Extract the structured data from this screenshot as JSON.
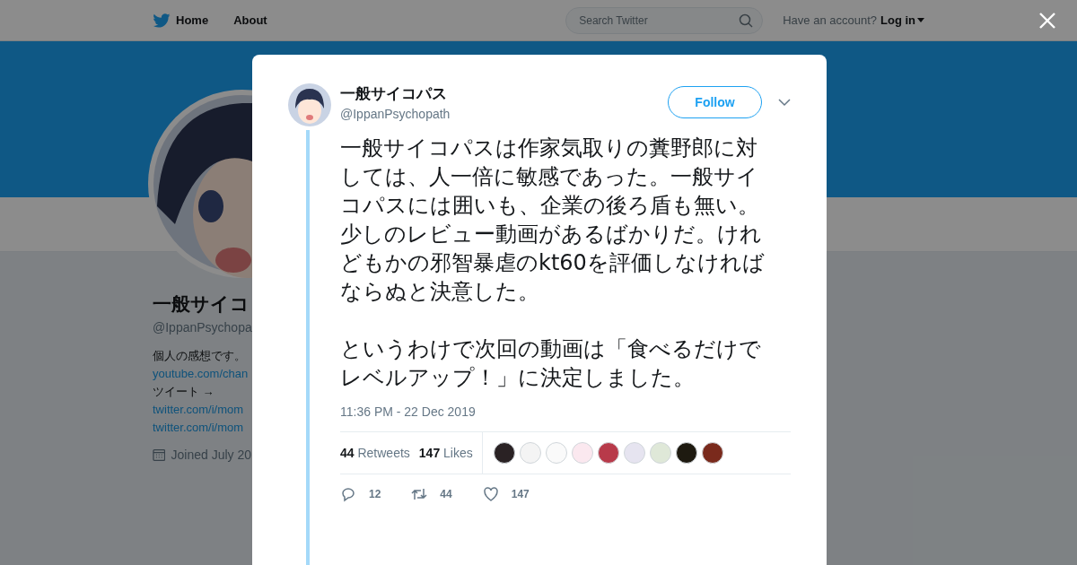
{
  "nav": {
    "items": [
      {
        "label": "Home"
      },
      {
        "label": "About"
      }
    ],
    "search": {
      "placeholder": "Search Twitter"
    },
    "account_prompt": "Have an account?",
    "login": "Log in"
  },
  "profile": {
    "name": "一般サイコ",
    "handle": "@IppanPsychopa",
    "bio": [
      {
        "kind": "text",
        "text": "個人の感想です。"
      },
      {
        "kind": "link",
        "text": "youtube.com/chan"
      },
      {
        "kind": "text",
        "text": "ツイート →"
      },
      {
        "kind": "link",
        "text": "twitter.com/i/mom"
      },
      {
        "kind": "link",
        "text": "twitter.com/i/mom"
      }
    ],
    "joined": "Joined July 20"
  },
  "tweet": {
    "name": "一般サイコパス",
    "handle": "@IppanPsychopath",
    "follow": "Follow",
    "paragraphs": [
      "一般サイコパスは作家気取りの糞野郎に対しては、人一倍に敏感であった。一般サイコパスには囲いも、企業の後ろ盾も無い。少しのレビュー動画があるばかりだ。けれどもかの邪智暴虐のkt60を評価しなければならぬと決意した。",
      "というわけで次回の動画は「食べるだけでレベルアップ！」に決定しました。"
    ],
    "time": "11:36 PM - 22 Dec 2019",
    "stats": [
      {
        "count": "44",
        "label": "Retweets"
      },
      {
        "count": "147",
        "label": "Likes"
      }
    ],
    "likers": [
      {
        "color": "#2a2224"
      },
      {
        "color": "#f4f4f4"
      },
      {
        "color": "#fafafa"
      },
      {
        "color": "#fbe8ef"
      },
      {
        "color": "#b83a4a"
      },
      {
        "color": "#e6e4f0"
      },
      {
        "color": "#dfe8d8"
      },
      {
        "color": "#1e1a10"
      },
      {
        "color": "#7a2a1c"
      }
    ],
    "actions": [
      {
        "kind": "reply",
        "count": "12"
      },
      {
        "kind": "retweet",
        "count": "44"
      },
      {
        "kind": "like",
        "count": "147"
      }
    ]
  }
}
